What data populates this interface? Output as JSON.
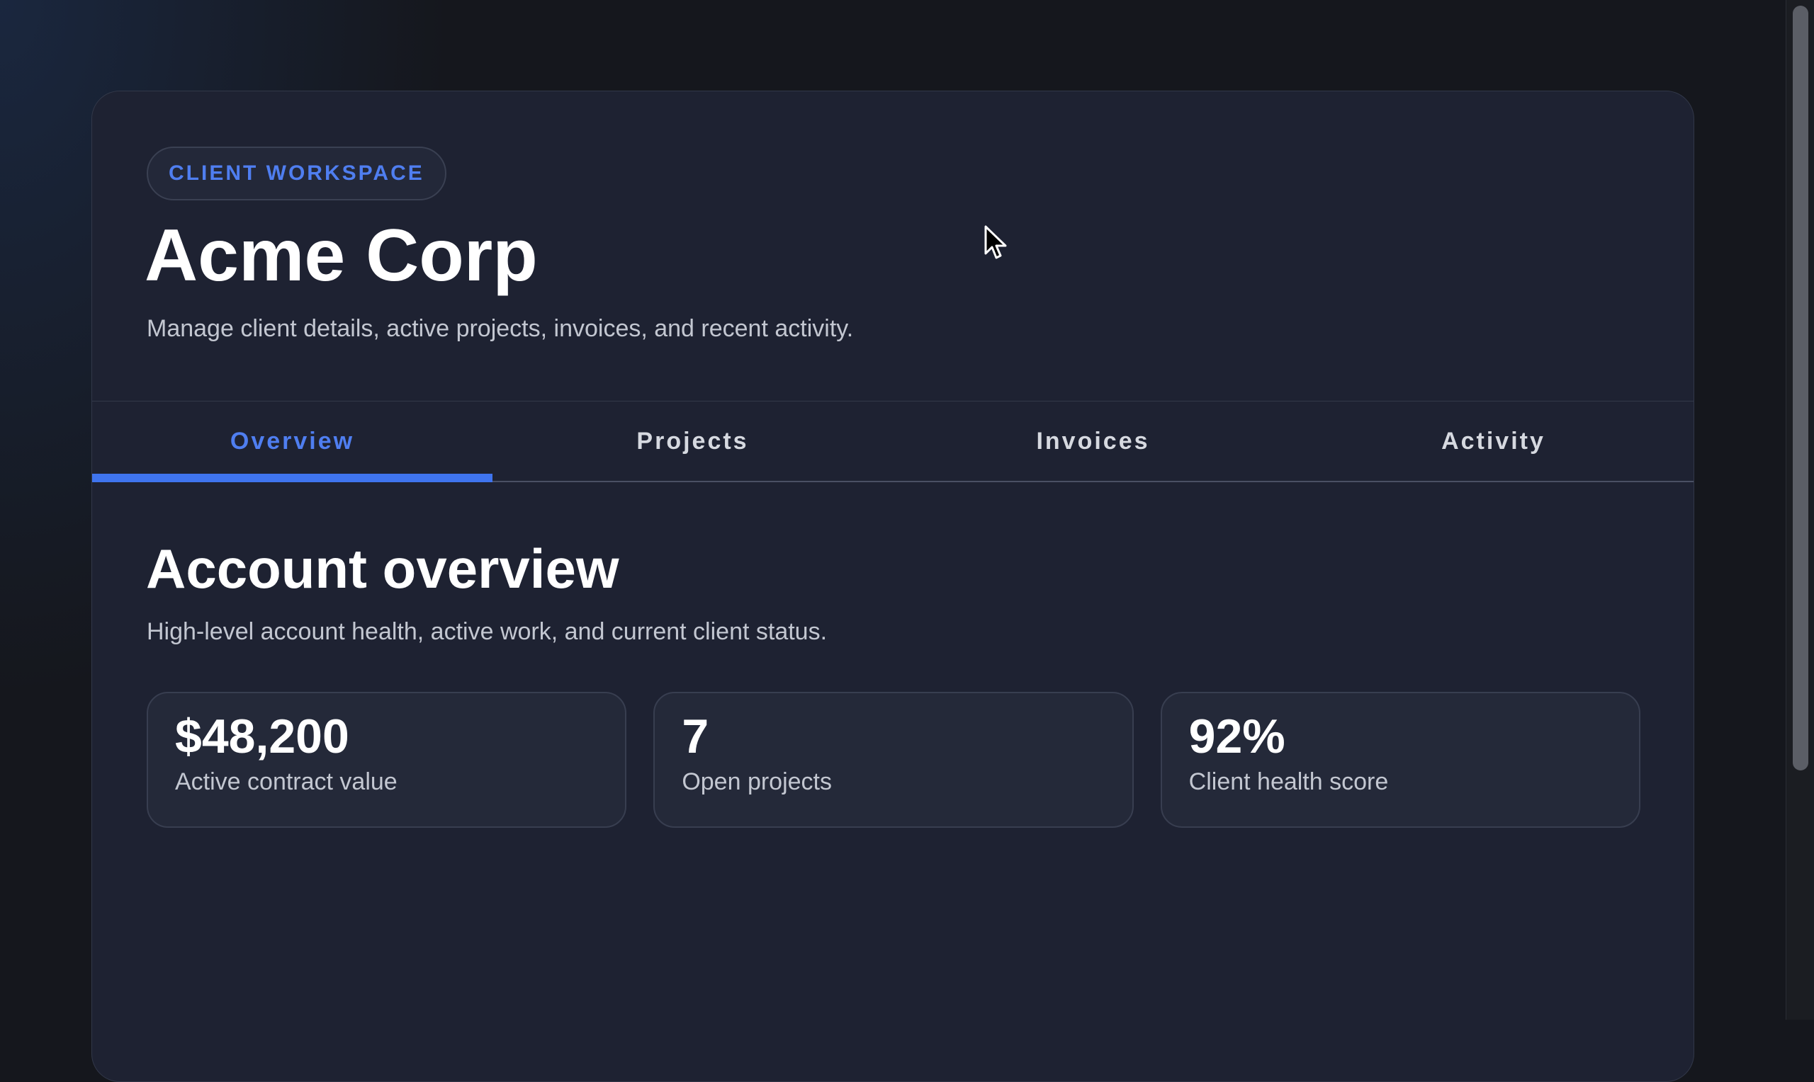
{
  "header": {
    "badge": "CLIENT WORKSPACE",
    "title": "Acme Corp",
    "subtitle": "Manage client details, active projects, invoices, and recent activity."
  },
  "tabs": [
    {
      "label": "Overview",
      "active": true
    },
    {
      "label": "Projects",
      "active": false
    },
    {
      "label": "Invoices",
      "active": false
    },
    {
      "label": "Activity",
      "active": false
    }
  ],
  "overview": {
    "title": "Account overview",
    "subtitle": "High-level account health, active work, and current client status.",
    "stats": [
      {
        "value": "$48,200",
        "label": "Active contract value"
      },
      {
        "value": "7",
        "label": "Open projects"
      },
      {
        "value": "92%",
        "label": "Client health score"
      }
    ]
  },
  "colors": {
    "accent": "#4f7ef0",
    "card_background": "#1e2232",
    "page_background": "#15171d"
  },
  "icons": {
    "cursor": "mouse-pointer-icon"
  }
}
